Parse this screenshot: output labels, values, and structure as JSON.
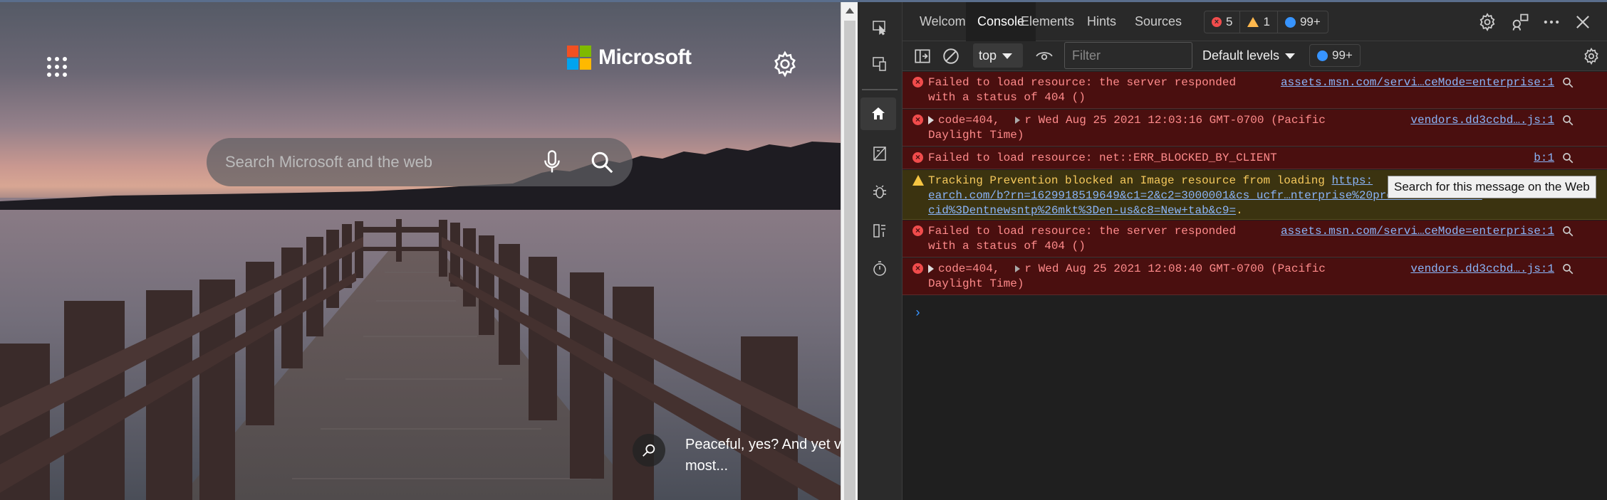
{
  "ntp": {
    "logo_text": "Microsoft",
    "logo_colors": [
      "#f25022",
      "#7fba00",
      "#00a4ef",
      "#ffb900"
    ],
    "search": {
      "placeholder": "Search Microsoft and the web"
    },
    "caption": "Peaceful, yes? And yet v most..."
  },
  "devtools": {
    "tabs": [
      {
        "label": "Welcome"
      },
      {
        "label": "Console",
        "active": true
      },
      {
        "label": "Elements"
      },
      {
        "label": "Hints"
      },
      {
        "label": "Sources"
      }
    ],
    "counts": {
      "errors": "5",
      "warnings": "1",
      "messages": "99+"
    },
    "toolbar": {
      "context": "top",
      "filter_placeholder": "Filter",
      "levels": "Default levels",
      "issues": "99+"
    },
    "messages": [
      {
        "type": "error",
        "text": "Failed to load resource: the server responded\nwith a status of 404 ()",
        "source": "assets.msn.com/servi…ceMode=enterprise:1"
      },
      {
        "type": "error",
        "text_a": "code=404,",
        "text_b": "r Wed Aug 25 2021 12:03:16 GMT-0700 (Pacific",
        "text_c": "Daylight Time)",
        "source": "vendors.dd3ccbd….js:1"
      },
      {
        "type": "error",
        "text": "Failed to load resource: net::ERR_BLOCKED_BY_CLIENT",
        "source": "b:1"
      },
      {
        "type": "warning",
        "text": "Tracking Prevention blocked an Image resource from loading",
        "link_1": "https:",
        "link_2": "earch.com/b?rn=1629918519649&c1=2&c2=3000001&cs_ucfr…nterprise%20prerender%3D1%20",
        "link_3": "cid%3Dentnewsntp%26mkt%3Den-us&c8=New+tab&c9=",
        "trail": "."
      },
      {
        "type": "error",
        "text": "Failed to load resource: the server responded\nwith a status of 404 ()",
        "source": "assets.msn.com/servi…ceMode=enterprise:1"
      },
      {
        "type": "error",
        "text_a": "code=404,",
        "text_b": "r Wed Aug 25 2021 12:08:40 GMT-0700 (Pacific",
        "text_c": "Daylight Time)",
        "source": "vendors.dd3ccbd….js:1"
      }
    ],
    "prompt": "›",
    "tooltip": "Search for this message on the Web"
  }
}
